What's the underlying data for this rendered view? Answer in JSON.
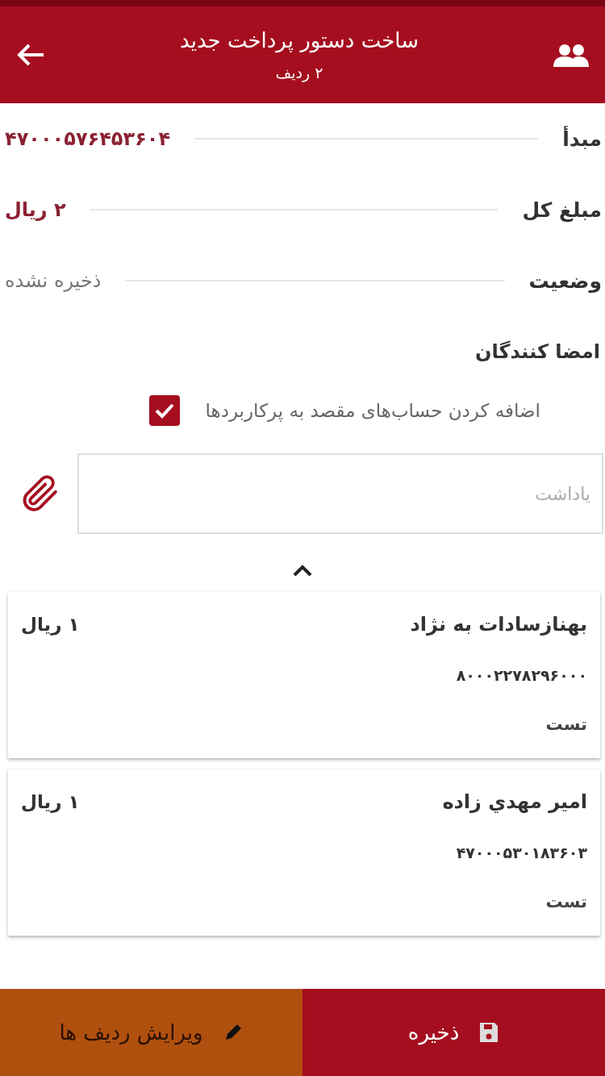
{
  "header": {
    "title": "ساخت دستور پرداخت جدید",
    "subtitle": "۲ ردیف"
  },
  "info": [
    {
      "label": "مبدأ",
      "value": "۴۷۰۰۰۵۷۶۴۵۳۶۰۴",
      "highlight": true
    },
    {
      "label": "مبلغ کل",
      "value": "۲ ریال",
      "highlight": true
    },
    {
      "label": "وضعیت",
      "value": "ذخیره نشده",
      "highlight": false
    }
  ],
  "signers_title": "امضا کنندگان",
  "add_accounts": {
    "label": "اضافه کردن حساب‌های مقصد به پرکاربردها",
    "checked": true
  },
  "note": {
    "placeholder": "یاداشت"
  },
  "collapse": {
    "expanded": true
  },
  "rows": [
    {
      "name": "بهنازسادات به نژاد",
      "amount": "۱ ریال",
      "account": "۸۰۰۰۲۲۷۸۲۹۶۰۰۰",
      "note": "تست"
    },
    {
      "name": "امير مهدي زاده",
      "amount": "۱ ریال",
      "account": "۴۷۰۰۰۵۳۰۱۸۳۶۰۳",
      "note": "تست"
    }
  ],
  "actions": {
    "save": "ذخیره",
    "edit": "ویرایش ردیف ها"
  }
}
